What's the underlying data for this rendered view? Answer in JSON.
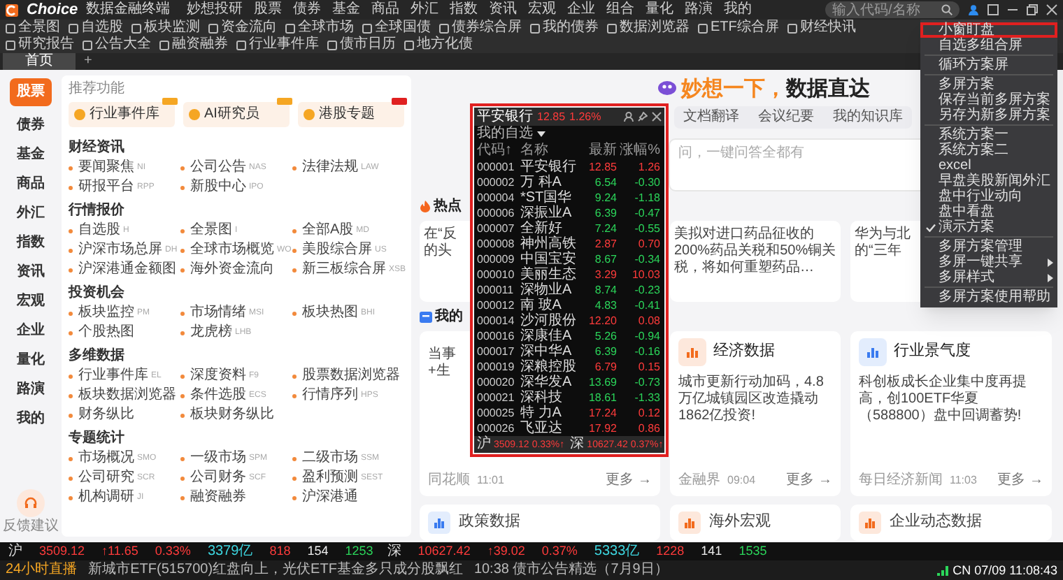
{
  "app": {
    "logo": "Choice",
    "subtitle": "数据金融终端",
    "menu": [
      "妙想投研",
      "股票",
      "债券",
      "基金",
      "商品",
      "外汇",
      "指数",
      "资讯",
      "宏观",
      "企业",
      "组合",
      "量化",
      "路演",
      "我的"
    ],
    "search": {
      "placeholder": "输入代码/名称"
    }
  },
  "toolbar": [
    "全景图",
    "自选股",
    "板块监测",
    "资金流向",
    "全球市场",
    "全球国债",
    "债券综合屏",
    "我的债券",
    "数据浏览器",
    "ETF综合屏",
    "财经快讯",
    "研究报告",
    "公告大全",
    "融资融券",
    "行业事件库",
    "债市日历",
    "地方化债"
  ],
  "tabs": [
    {
      "label": "首页",
      "selected": true
    }
  ],
  "add_tab": "+",
  "nav": [
    {
      "label": "股票",
      "selected": true
    },
    {
      "label": "债券",
      "selected": false
    },
    {
      "label": "基金",
      "selected": false
    },
    {
      "label": "商品",
      "selected": false
    },
    {
      "label": "外汇",
      "selected": false
    },
    {
      "label": "指数",
      "selected": false
    },
    {
      "label": "资讯",
      "selected": false
    },
    {
      "label": "宏观",
      "selected": false
    },
    {
      "label": "企业",
      "selected": false
    },
    {
      "label": "量化",
      "selected": false
    },
    {
      "label": "路演",
      "selected": false
    },
    {
      "label": "我的",
      "selected": false
    }
  ],
  "feedback": "反馈建议",
  "featured": {
    "title": "推荐功能",
    "items": [
      {
        "label": "行业事件库",
        "color": "#f5a623"
      },
      {
        "label": "AI研究员",
        "color": "#f5a623"
      },
      {
        "label": "港股专题",
        "color": "#e02020"
      }
    ]
  },
  "sections": [
    {
      "title": "财经资讯",
      "items": [
        {
          "label": "要闻聚焦",
          "code": "NI"
        },
        {
          "label": "公司公告",
          "code": "NAS"
        },
        {
          "label": "法律法规",
          "code": "LAW"
        },
        {
          "label": "研报平台",
          "code": "RPP"
        },
        {
          "label": "新股中心",
          "code": "IPO"
        }
      ]
    },
    {
      "title": "行情报价",
      "items": [
        {
          "label": "自选股",
          "code": "H"
        },
        {
          "label": "全景图",
          "code": "I"
        },
        {
          "label": "全部A股",
          "code": "MD"
        },
        {
          "label": "沪深市场总屏",
          "code": "DH"
        },
        {
          "label": "全球市场概览",
          "code": "WO"
        },
        {
          "label": "美股综合屏",
          "code": "US"
        },
        {
          "label": "沪深港通金额图"
        },
        {
          "label": "海外资金流向"
        },
        {
          "label": "新三板综合屏",
          "code": "XSB"
        }
      ]
    },
    {
      "title": "投资机会",
      "items": [
        {
          "label": "板块监控",
          "code": "PM"
        },
        {
          "label": "市场情绪",
          "code": "MSI"
        },
        {
          "label": "板块热图",
          "code": "BHI"
        },
        {
          "label": "个股热图"
        },
        {
          "label": "龙虎榜",
          "code": "LHB"
        }
      ]
    },
    {
      "title": "多维数据",
      "items": [
        {
          "label": "行业事件库",
          "code": "EL"
        },
        {
          "label": "深度资料",
          "code": "F9"
        },
        {
          "label": "股票数据浏览器"
        },
        {
          "label": "板块数据浏览器"
        },
        {
          "label": "条件选股",
          "code": "ECS"
        },
        {
          "label": "行情序列",
          "code": "HPS"
        },
        {
          "label": "财务纵比"
        },
        {
          "label": "板块财务纵比"
        }
      ]
    },
    {
      "title": "专题统计",
      "items": [
        {
          "label": "市场概况",
          "code": "SMO"
        },
        {
          "label": "一级市场",
          "code": "SPM"
        },
        {
          "label": "二级市场",
          "code": "SSM"
        },
        {
          "label": "公司研究",
          "code": "SCR"
        },
        {
          "label": "公司财务",
          "code": "SCF"
        },
        {
          "label": "盈利预测",
          "code": "SEST"
        },
        {
          "label": "机构调研",
          "code": "JI"
        },
        {
          "label": "融资融券"
        },
        {
          "label": "沪深港通"
        }
      ]
    }
  ],
  "assistant": {
    "title_accent": "妙想一下，",
    "title": "数据直达",
    "tabs": [
      "文档翻译",
      "会议纪要",
      "我的知识库"
    ],
    "input": {
      "placeholder": "问，一键问答全都有"
    }
  },
  "hot": {
    "title": "热点",
    "cards": [
      {
        "lines": [
          "在“反",
          "的头"
        ]
      },
      {
        "lines": [
          "美拟对进口药品征收的200%药品关税和50%铜关税，将如何重塑药品…"
        ]
      },
      {
        "lines": [
          "华为与北",
          "的“三年"
        ]
      }
    ]
  },
  "my_data": {
    "title": "我的",
    "cards": [
      {
        "lines": [
          "当事",
          "+生"
        ],
        "source": "同花顺",
        "time": "11:01",
        "more": "更多 →"
      },
      {
        "title": "经济数据",
        "lines": [
          "城市更新行动加码，4.8万亿城镇园区改造撬动1862亿投资!"
        ],
        "source": "金融界",
        "time": "09:04",
        "more": "更多 →"
      },
      {
        "title": "行业景气度",
        "lines": [
          "科创板成长企业集中度再提高，创100ETF华夏（588800）盘中回调蓄势!"
        ],
        "source": "每日经济新闻",
        "time": "11:03",
        "more": "更多 →"
      }
    ],
    "more_cards": [
      "政策数据",
      "海外宏观",
      "企业动态数据"
    ]
  },
  "watchlist": {
    "highlighted": true,
    "stock": "平安银行",
    "price": "12.85",
    "change": "1.26%",
    "group": "我的自选",
    "columns": [
      "代码↑",
      "名称",
      "最新",
      "涨幅%"
    ],
    "rows": [
      {
        "code": "000001",
        "name": "平安银行",
        "price": "12.85",
        "change": "1.26",
        "kind": "up"
      },
      {
        "code": "000002",
        "name": "万 科A",
        "price": "6.54",
        "change": "-0.30",
        "kind": "down"
      },
      {
        "code": "000004",
        "name": "*ST国华",
        "price": "9.24",
        "change": "-1.18",
        "kind": "down"
      },
      {
        "code": "000006",
        "name": "深振业A",
        "price": "6.39",
        "change": "-0.47",
        "kind": "down"
      },
      {
        "code": "000007",
        "name": "全新好",
        "price": "7.24",
        "change": "-0.55",
        "kind": "down"
      },
      {
        "code": "000008",
        "name": "神州高铁",
        "price": "2.87",
        "change": "0.70",
        "kind": "up"
      },
      {
        "code": "000009",
        "name": "中国宝安",
        "price": "8.67",
        "change": "-0.34",
        "kind": "down"
      },
      {
        "code": "000010",
        "name": "美丽生态",
        "price": "3.29",
        "change": "10.03",
        "kind": "up"
      },
      {
        "code": "000011",
        "name": "深物业A",
        "price": "8.74",
        "change": "-0.23",
        "kind": "down"
      },
      {
        "code": "000012",
        "name": "南 玻A",
        "price": "4.83",
        "change": "-0.41",
        "kind": "down"
      },
      {
        "code": "000014",
        "name": "沙河股份",
        "price": "12.20",
        "change": "0.08",
        "kind": "up"
      },
      {
        "code": "000016",
        "name": "深康佳A",
        "price": "5.26",
        "change": "-0.94",
        "kind": "down"
      },
      {
        "code": "000017",
        "name": "深中华A",
        "price": "6.39",
        "change": "-0.16",
        "kind": "down"
      },
      {
        "code": "000019",
        "name": "深粮控股",
        "price": "6.79",
        "change": "0.15",
        "kind": "up"
      },
      {
        "code": "000020",
        "name": "深华发A",
        "price": "13.69",
        "change": "-0.73",
        "kind": "down"
      },
      {
        "code": "000021",
        "name": "深科技",
        "price": "18.61",
        "change": "-1.33",
        "kind": "down"
      },
      {
        "code": "000025",
        "name": "特 力A",
        "price": "17.24",
        "change": "0.12",
        "kind": "up"
      },
      {
        "code": "000026",
        "name": "飞亚达",
        "price": "17.92",
        "change": "0.86",
        "kind": "up"
      }
    ],
    "footer": [
      {
        "label": "沪",
        "value": "3509.12",
        "change": "0.33%↑"
      },
      {
        "label": "深",
        "value": "10627.42",
        "change": "0.37%↑"
      }
    ]
  },
  "dropdown": {
    "groups": [
      {
        "items": [
          {
            "label": "小窗盯盘",
            "highlighted": true,
            "checked": false,
            "submenu": false
          },
          {
            "label": "自选多组合屏",
            "highlighted": false,
            "checked": false,
            "submenu": false
          }
        ]
      },
      {
        "items": [
          {
            "label": "循环方案屏",
            "highlighted": false,
            "checked": false,
            "submenu": false
          }
        ]
      },
      {
        "items": [
          {
            "label": "多屏方案",
            "highlighted": false,
            "checked": false,
            "submenu": false
          },
          {
            "label": "保存当前多屏方案",
            "highlighted": false,
            "checked": false,
            "submenu": false
          },
          {
            "label": "另存为新多屏方案",
            "highlighted": false,
            "checked": false,
            "submenu": false
          }
        ]
      },
      {
        "items": [
          {
            "label": "系统方案一",
            "highlighted": false,
            "checked": false,
            "submenu": false
          },
          {
            "label": "系统方案二",
            "highlighted": false,
            "checked": false,
            "submenu": false
          },
          {
            "label": "excel",
            "highlighted": false,
            "checked": false,
            "submenu": false
          },
          {
            "label": "早盘美股新闻外汇",
            "highlighted": false,
            "checked": false,
            "submenu": false
          },
          {
            "label": "盘中行业动向",
            "highlighted": false,
            "checked": false,
            "submenu": false
          },
          {
            "label": "盘中看盘",
            "highlighted": false,
            "checked": false,
            "submenu": false
          },
          {
            "label": "演示方案",
            "highlighted": false,
            "checked": true,
            "submenu": false
          }
        ]
      },
      {
        "items": [
          {
            "label": "多屏方案管理",
            "highlighted": false,
            "checked": false,
            "submenu": false
          },
          {
            "label": "多屏一键共享",
            "highlighted": false,
            "checked": false,
            "submenu": true
          },
          {
            "label": "多屏样式",
            "highlighted": false,
            "checked": false,
            "submenu": true
          }
        ]
      },
      {
        "items": [
          {
            "label": "多屏方案使用帮助",
            "highlighted": false,
            "checked": false,
            "submenu": false
          }
        ]
      }
    ]
  },
  "ticker": [
    {
      "label": "沪",
      "value": "3509.12",
      "change": "↑11.65",
      "pct": "0.33%",
      "amount": "3379亿",
      "up": "818",
      "flat": "154",
      "down": "1253"
    },
    {
      "label": "深",
      "value": "10627.42",
      "change": "↑39.02",
      "pct": "0.37%",
      "amount": "5333亿",
      "up": "1228",
      "flat": "141",
      "down": "1535"
    }
  ],
  "news": {
    "label": "24小时直播",
    "items": [
      "新城市ETF(515700)红盘向上，光伏ETF基金多只成分股飘红",
      "10:38 债市公告精选（7月9日）"
    ]
  },
  "clock": "CN 07/09 11:08:43"
}
